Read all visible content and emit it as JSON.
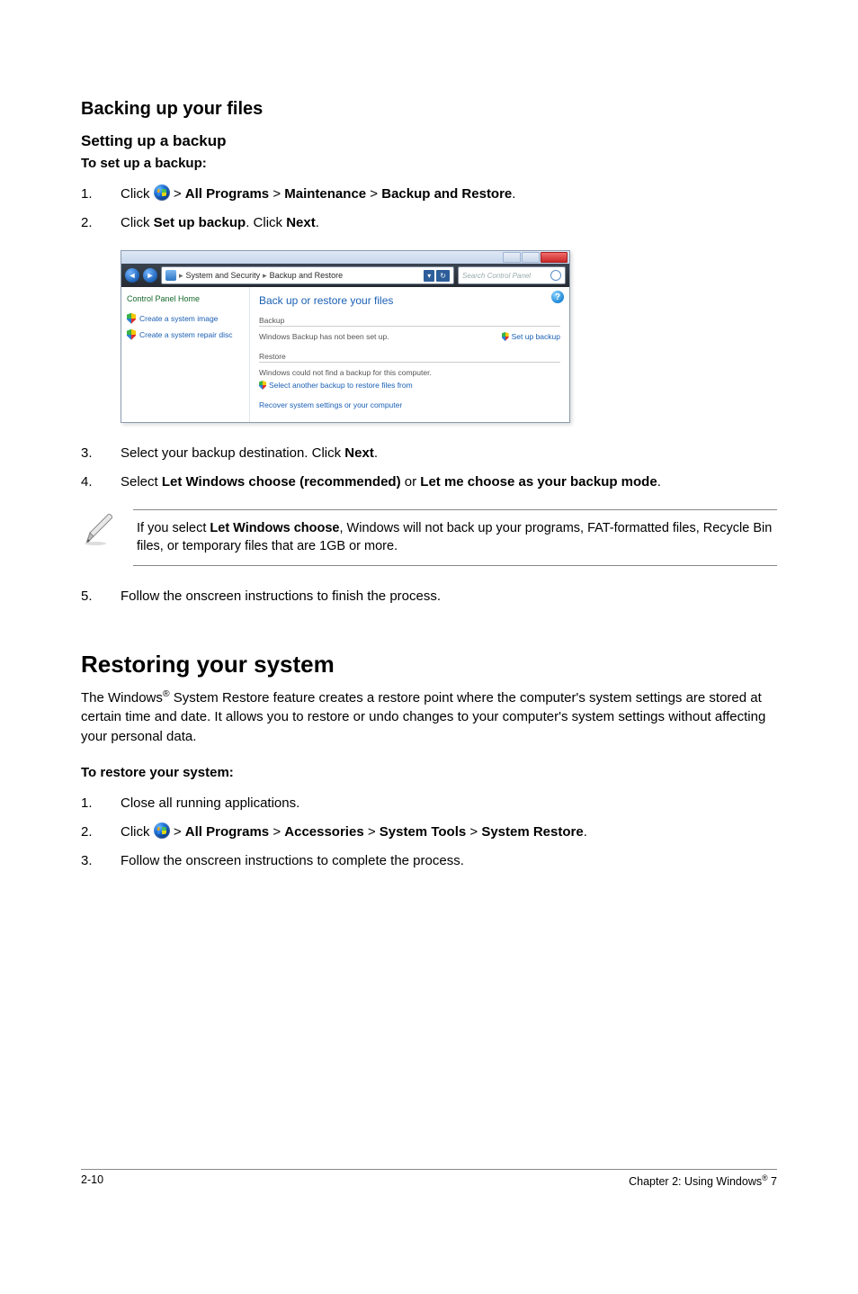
{
  "section1": {
    "h2": "Backing up your files",
    "h3": "Setting up a backup",
    "h4": "To set up a backup:"
  },
  "steps_a": {
    "1": {
      "num": "1.",
      "pre": "Click ",
      "post": " > ",
      "b1": "All Programs",
      "b2": "Maintenance",
      "b3": "Backup and Restore",
      "dot": "."
    },
    "2": {
      "num": "2.",
      "t1": "Click ",
      "b1": "Set up backup",
      "t2": ". Click ",
      "b2": "Next",
      "t3": "."
    },
    "3": {
      "num": "3.",
      "t1": "Select your backup destination. Click ",
      "b1": "Next",
      "t2": "."
    },
    "4": {
      "num": "4.",
      "t1": "Select ",
      "b1": "Let Windows choose (recommended)",
      "t2": " or ",
      "b2": "Let me choose as your backup mode",
      "t3": "."
    },
    "5": {
      "num": "5.",
      "t1": "Follow the onscreen instructions to finish the process."
    }
  },
  "note": {
    "t1": "If you select ",
    "b1": "Let Windows choose",
    "t2": ", Windows will not back up your programs, FAT-formatted files, Recycle Bin files, or temporary files that are 1GB or more."
  },
  "win": {
    "crumb": {
      "a": "System and Security",
      "b": "Backup and Restore"
    },
    "search_ph": "Search Control Panel",
    "side": {
      "home": "Control Panel Home",
      "l1": "Create a system image",
      "l2": "Create a system repair disc"
    },
    "main_h": "Back up or restore your files",
    "g1": {
      "label": "Backup",
      "text": "Windows Backup has not been set up.",
      "action": "Set up backup"
    },
    "g2": {
      "label": "Restore",
      "text": "Windows could not find a backup for this computer.",
      "action": "Select another backup to restore files from"
    },
    "foot": "Recover system settings or your computer"
  },
  "section2": {
    "h1": "Restoring your system",
    "para": "The Windows® System Restore feature creates a restore point where the computer's system settings are stored at certain time and date. It allows you to restore or undo changes to your computer's system settings without affecting your personal data.",
    "h4": "To restore your system:"
  },
  "steps_b": {
    "1": {
      "num": "1.",
      "t1": "Close all running applications."
    },
    "2": {
      "num": "2.",
      "pre": "Click ",
      "post": " > ",
      "b1": "All Programs",
      "b2": "Accessories",
      "b3": "System Tools",
      "b4": "System Restore",
      "dot": "."
    },
    "3": {
      "num": "3.",
      "t1": "Follow the onscreen instructions to complete the process."
    }
  },
  "pagefoot": {
    "left": "2-10",
    "right_pre": "Chapter 2: Using Windows",
    "right_post": " 7"
  }
}
